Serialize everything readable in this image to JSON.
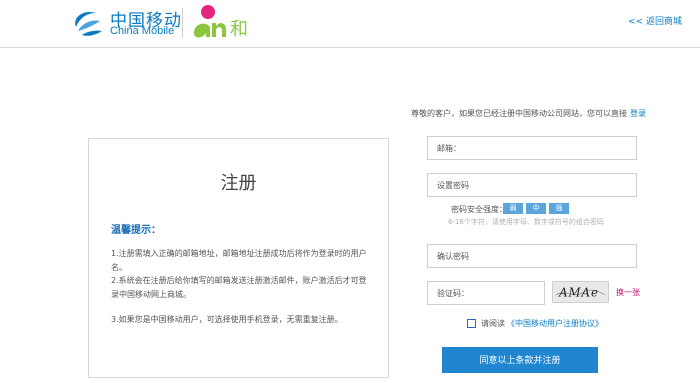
{
  "header": {
    "brand_cn": "中国移动",
    "brand_en": "China Mobile",
    "sub_brand": "和",
    "back_link": "<< 返回商城"
  },
  "notice": {
    "title": "注册",
    "tip_heading": "温馨提示：",
    "items": [
      "1.注册需填入正确的邮箱地址，邮箱地址注册成功后将作为登录时的用户名。",
      "2.系统会在注册后给你填写的邮箱发送注册激活邮件，账户激活后才可登录中国移动网上商城。",
      "3.如果您是中国移动用户，可选择使用手机登录，无需重复注册。"
    ]
  },
  "form": {
    "intro": "尊敬的客户，如果您已经注册中国移动公司网站，您可以直接",
    "login_link": "登录",
    "email_label": "邮箱：",
    "email_value": "",
    "password_label": "设置密码",
    "password_value": "",
    "strength_label": "密码安全强度：",
    "strength_levels": [
      "弱",
      "中",
      "强"
    ],
    "password_hint": "6-16个字符，请使用字母、数字或符号的组合密码",
    "confirm_label": "确认密码",
    "confirm_value": "",
    "captcha_label": "验证码：",
    "captcha_value": "",
    "captcha_text": "AMAe",
    "refresh_link": "换一张",
    "agree_prefix": "请阅读",
    "agreement_link": "《中国移动用户注册协议》",
    "submit_label": "同意以上条款并注册"
  },
  "colors": {
    "brand_blue": "#0a7bc2",
    "button_blue": "#1f86cf",
    "strength_blue": "#5aa6dc",
    "accent_magenta": "#c0136e",
    "and_green": "#8cc63f"
  }
}
